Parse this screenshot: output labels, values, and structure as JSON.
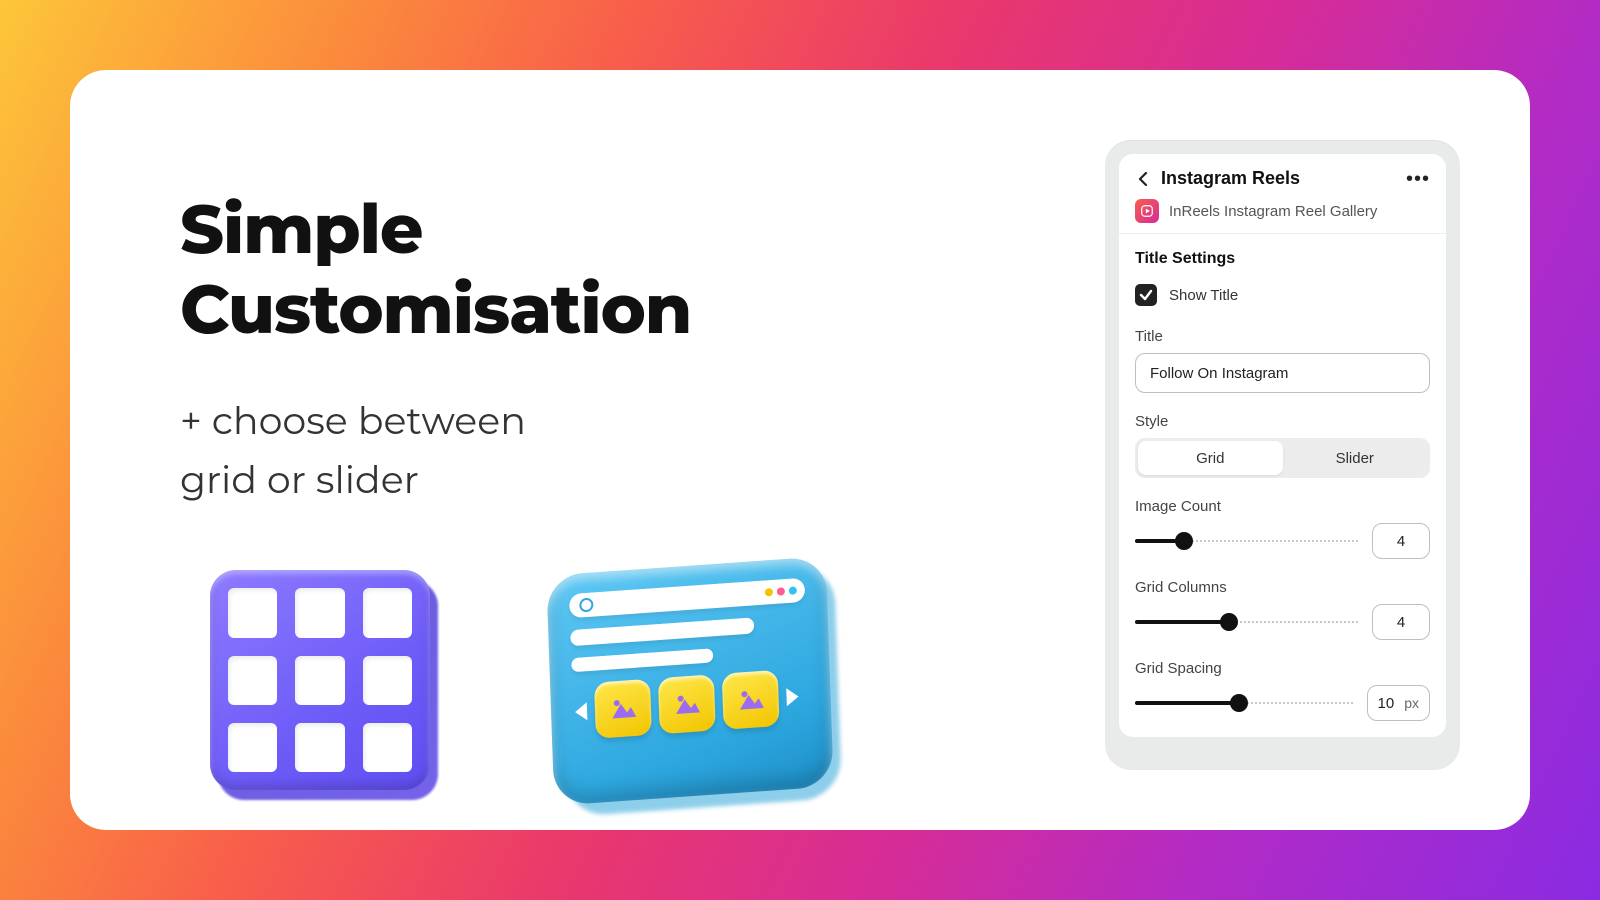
{
  "hero": {
    "headline_line1": "Simple",
    "headline_line2": "Customisation",
    "sub_line1": "+ choose between",
    "sub_line2": "grid or slider"
  },
  "panel": {
    "header_title": "Instagram Reels",
    "app_name": "InReels Instagram Reel Gallery",
    "section_title": "Title Settings",
    "show_title_label": "Show Title",
    "show_title_checked": true,
    "title_label": "Title",
    "title_value": "Follow On Instagram",
    "style_label": "Style",
    "style_options": {
      "grid": "Grid",
      "slider": "Slider"
    },
    "style_selected": "grid",
    "image_count": {
      "label": "Image Count",
      "value": "4",
      "fill": 22
    },
    "grid_columns": {
      "label": "Grid Columns",
      "value": "4",
      "fill": 42
    },
    "grid_spacing": {
      "label": "Grid Spacing",
      "value": "10",
      "unit": "px",
      "fill": 48
    }
  }
}
